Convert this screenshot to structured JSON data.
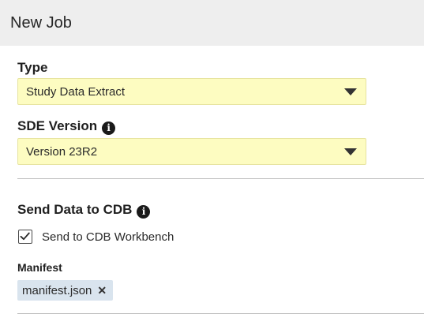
{
  "header": {
    "title": "New Job"
  },
  "form": {
    "type": {
      "label": "Type",
      "value": "Study Data Extract",
      "icon": "chevron-down-icon"
    },
    "sde_version": {
      "label": "SDE Version",
      "value": "Version 23R2",
      "info_glyph": "i",
      "icon": "chevron-down-icon"
    },
    "send_data": {
      "title": "Send Data to CDB",
      "info_glyph": "i",
      "checkbox": {
        "label": "Send to CDB Workbench",
        "checked": true
      }
    },
    "manifest": {
      "label": "Manifest",
      "chip": {
        "value": "manifest.json",
        "remove_glyph": "✕"
      }
    }
  },
  "colors": {
    "header_bg": "#eeeeee",
    "select_bg": "#fdfcc1",
    "chip_bg": "#d9e4ee",
    "divider": "#bdbdbd"
  }
}
